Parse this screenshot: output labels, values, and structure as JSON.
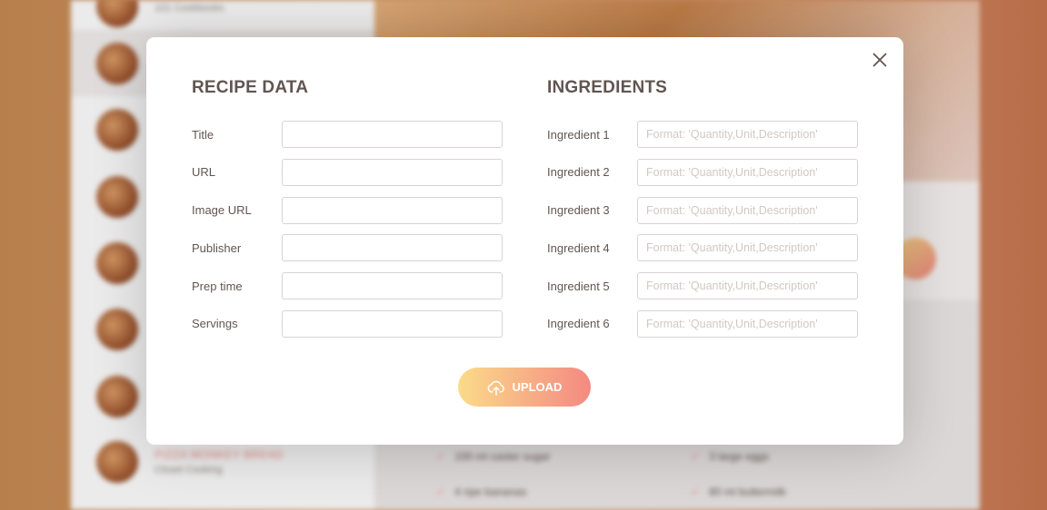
{
  "background": {
    "results": [
      {
        "publisher": "101 Cookbooks"
      },
      {
        "title": "",
        "publisher": ""
      },
      {
        "title": "",
        "publisher": ""
      },
      {
        "title": "",
        "publisher": ""
      },
      {
        "title": "",
        "publisher": ""
      },
      {
        "title": "",
        "publisher": ""
      },
      {
        "title": "",
        "publisher": ""
      },
      {
        "title": "Pizza Monkey Bread",
        "publisher": "Closet Cooking"
      }
    ],
    "ingredients": [
      "100 ml caster sugar",
      "3 large eggs",
      "4 ripe bananas",
      "80 ml buttermilk"
    ]
  },
  "modal": {
    "recipe_heading": "Recipe data",
    "ingredients_heading": "Ingredients",
    "fields": [
      {
        "label": "Title",
        "value": ""
      },
      {
        "label": "URL",
        "value": ""
      },
      {
        "label": "Image URL",
        "value": ""
      },
      {
        "label": "Publisher",
        "value": ""
      },
      {
        "label": "Prep time",
        "value": ""
      },
      {
        "label": "Servings",
        "value": ""
      }
    ],
    "ingredients": [
      {
        "label": "Ingredient 1",
        "placeholder": "Format: 'Quantity,Unit,Description'"
      },
      {
        "label": "Ingredient 2",
        "placeholder": "Format: 'Quantity,Unit,Description'"
      },
      {
        "label": "Ingredient 3",
        "placeholder": "Format: 'Quantity,Unit,Description'"
      },
      {
        "label": "Ingredient 4",
        "placeholder": "Format: 'Quantity,Unit,Description'"
      },
      {
        "label": "Ingredient 5",
        "placeholder": "Format: 'Quantity,Unit,Description'"
      },
      {
        "label": "Ingredient 6",
        "placeholder": "Format: 'Quantity,Unit,Description'"
      }
    ],
    "upload_label": "Upload",
    "close_icon": "close-icon",
    "upload_icon": "cloud-upload-icon"
  },
  "colors": {
    "accent_start": "#fbdb89",
    "accent_end": "#f48982",
    "text": "#615551"
  }
}
